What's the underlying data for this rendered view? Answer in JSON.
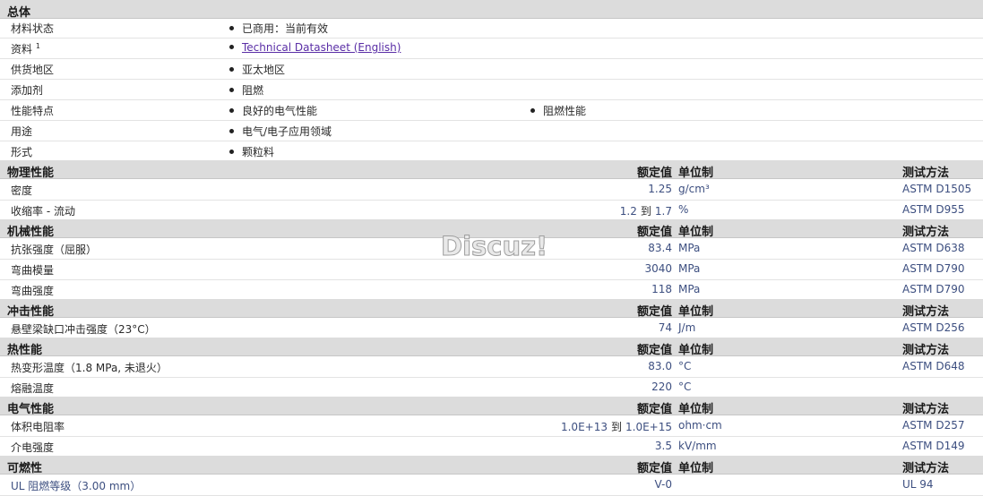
{
  "general": {
    "title": "总体",
    "rows": [
      {
        "label": "材料状态",
        "sup": "",
        "items": [
          "已商用：当前有效"
        ]
      },
      {
        "label": "资料",
        "sup": "1",
        "items": [
          "Technical Datasheet (English)"
        ]
      },
      {
        "label": "供货地区",
        "sup": "",
        "items": [
          "亚太地区"
        ]
      },
      {
        "label": "添加剂",
        "sup": "",
        "items": [
          "阻燃"
        ]
      },
      {
        "label": "性能特点",
        "sup": "",
        "items": [
          "良好的电气性能",
          "阻燃性能"
        ]
      },
      {
        "label": "用途",
        "sup": "",
        "items": [
          "电气/电子应用领域"
        ]
      },
      {
        "label": "形式",
        "sup": "",
        "items": [
          "颗粒料"
        ]
      }
    ]
  },
  "headers": {
    "value": "额定值",
    "unit": "单位制",
    "test": "测试方法"
  },
  "sections": [
    {
      "title": "物理性能",
      "rows": [
        {
          "label": "密度",
          "value": "1.25",
          "unit": "g/cm³",
          "test": "ASTM D1505"
        },
        {
          "label": "收缩率 - 流动",
          "value_from": "1.2",
          "to": "到",
          "value_to": "1.7",
          "unit": "%",
          "test": "ASTM D955"
        }
      ]
    },
    {
      "title": "机械性能",
      "rows": [
        {
          "label": "抗张强度（屈服）",
          "value": "83.4",
          "unit": "MPa",
          "test": "ASTM D638"
        },
        {
          "label": "弯曲模量",
          "value": "3040",
          "unit": "MPa",
          "test": "ASTM D790"
        },
        {
          "label": "弯曲强度",
          "value": "118",
          "unit": "MPa",
          "test": "ASTM D790"
        }
      ]
    },
    {
      "title": "冲击性能",
      "rows": [
        {
          "label": "悬壁梁缺口冲击强度（23°C）",
          "value": "74",
          "unit": "J/m",
          "test": "ASTM D256"
        }
      ]
    },
    {
      "title": "热性能",
      "rows": [
        {
          "label": "热变形温度（1.8 MPa, 未退火）",
          "value": "83.0",
          "unit": "°C",
          "test": "ASTM D648"
        },
        {
          "label": "熔融温度",
          "value": "220",
          "unit": "°C",
          "test": ""
        }
      ]
    },
    {
      "title": "电气性能",
      "rows": [
        {
          "label": "体积电阻率",
          "value_from": "1.0E+13",
          "to": "到",
          "value_to": "1.0E+15",
          "unit": "ohm·cm",
          "test": "ASTM D257"
        },
        {
          "label": "介电强度",
          "value": "3.5",
          "unit": "kV/mm",
          "test": "ASTM D149"
        }
      ]
    },
    {
      "title": "可燃性",
      "rows": [
        {
          "label": "UL 阻燃等级（3.00 mm）",
          "value": "V-0",
          "unit": "",
          "test": "UL 94"
        }
      ]
    }
  ],
  "watermark": "Discuz!"
}
